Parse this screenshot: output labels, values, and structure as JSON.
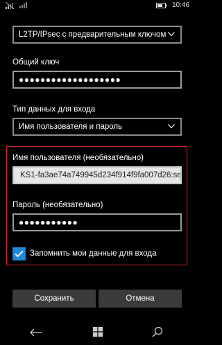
{
  "status_bar": {
    "time": "10:46",
    "icons": [
      "signal-icon",
      "wifi-icon",
      "battery-icon"
    ]
  },
  "vpn_type": {
    "selected": "L2TP/IPsec с предварительным ключом"
  },
  "preshared_key": {
    "label": "Общий ключ",
    "value": "●●●●●●●●●●●●●●●●●●●"
  },
  "signin_type": {
    "label": "Тип данных для входа",
    "selected": "Имя пользователя и пароль"
  },
  "username": {
    "label": "Имя пользователя (необязательно)",
    "value": "KS1-fa3ae74a749945d234f914f9fa007d26:se"
  },
  "password": {
    "label": "Пароль (необязательно)",
    "value": "●●●●●●●●●●●"
  },
  "remember": {
    "label": "Запомнить мои данные для входа",
    "checked": true
  },
  "actions": {
    "save": "Сохранить",
    "cancel": "Отмена"
  },
  "colors": {
    "accent": "#1e88d8",
    "highlight_border": "#d0262d",
    "button_bg": "#3b3b3b"
  }
}
